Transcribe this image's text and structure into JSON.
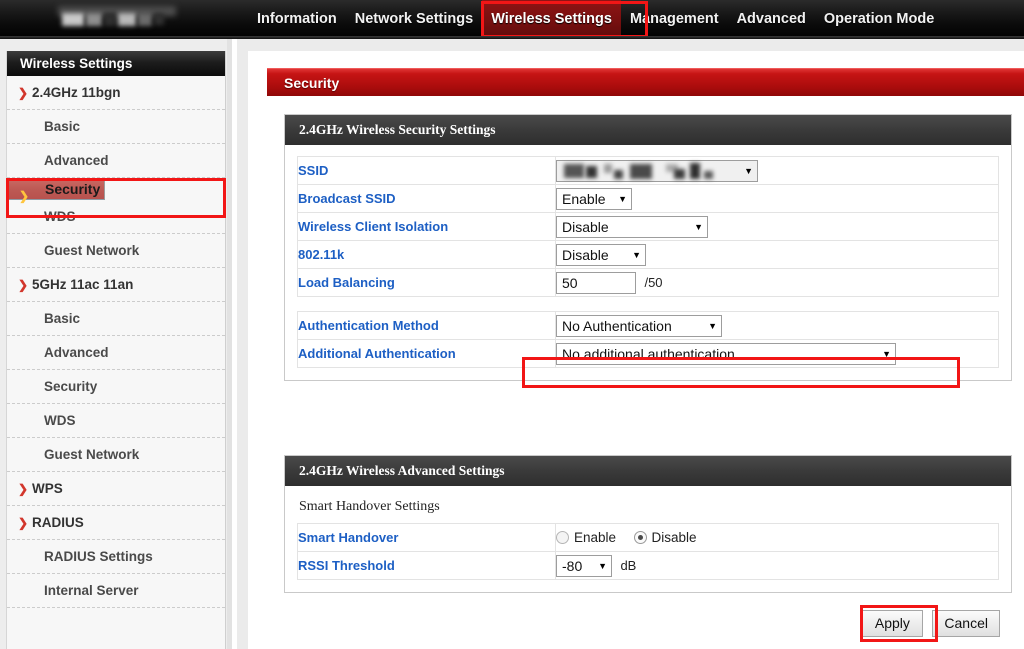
{
  "topnav": {
    "logo_alt": "redacted-vendor-logo",
    "items": [
      {
        "label": "Information",
        "active": false
      },
      {
        "label": "Network Settings",
        "active": false
      },
      {
        "label": "Wireless Settings",
        "active": true
      },
      {
        "label": "Management",
        "active": false
      },
      {
        "label": "Advanced",
        "active": false
      },
      {
        "label": "Operation Mode",
        "active": false
      }
    ]
  },
  "sidebar": {
    "title": "Wireless Settings",
    "items": [
      {
        "label": "2.4GHz 11bgn",
        "type": "group",
        "selected": false
      },
      {
        "label": "Basic",
        "type": "child",
        "selected": false
      },
      {
        "label": "Advanced",
        "type": "child",
        "selected": false
      },
      {
        "label": "Security",
        "type": "child",
        "selected": true
      },
      {
        "label": "WDS",
        "type": "child",
        "selected": false
      },
      {
        "label": "Guest Network",
        "type": "child",
        "selected": false
      },
      {
        "label": "5GHz 11ac 11an",
        "type": "group",
        "selected": false
      },
      {
        "label": "Basic",
        "type": "child",
        "selected": false
      },
      {
        "label": "Advanced",
        "type": "child",
        "selected": false
      },
      {
        "label": "Security",
        "type": "child",
        "selected": false
      },
      {
        "label": "WDS",
        "type": "child",
        "selected": false
      },
      {
        "label": "Guest Network",
        "type": "child",
        "selected": false
      },
      {
        "label": "WPS",
        "type": "group",
        "selected": false
      },
      {
        "label": "RADIUS",
        "type": "group",
        "selected": false
      },
      {
        "label": "RADIUS Settings",
        "type": "child",
        "selected": false
      },
      {
        "label": "Internal Server",
        "type": "child",
        "selected": false
      }
    ]
  },
  "page": {
    "header": "Security"
  },
  "security_panel": {
    "title": "2.4GHz Wireless Security Settings",
    "rows": {
      "ssid": {
        "label": "SSID",
        "value": "",
        "value_redacted": true
      },
      "broadcast_ssid": {
        "label": "Broadcast SSID",
        "value": "Enable"
      },
      "client_isolation": {
        "label": "Wireless Client Isolation",
        "value": "Disable"
      },
      "dot11k": {
        "label": "802.11k",
        "value": "Disable"
      },
      "load_balancing": {
        "label": "Load Balancing",
        "value": "50",
        "suffix": "/50"
      },
      "auth_method": {
        "label": "Authentication Method",
        "value": "No Authentication"
      },
      "additional_auth": {
        "label": "Additional Authentication",
        "value": "No additional authentication"
      }
    }
  },
  "advanced_panel": {
    "title": "2.4GHz Wireless Advanced Settings",
    "subheader": "Smart Handover Settings",
    "rows": {
      "smart_handover": {
        "label": "Smart Handover",
        "options": [
          {
            "label": "Enable",
            "selected": false
          },
          {
            "label": "Disable",
            "selected": true
          }
        ]
      },
      "rssi_threshold": {
        "label": "RSSI Threshold",
        "value": "-80",
        "unit": "dB"
      }
    }
  },
  "buttons": {
    "apply": "Apply",
    "cancel": "Cancel"
  },
  "icons": {
    "caret_down": "▼",
    "chevron_right": "❯"
  },
  "colors": {
    "highlight_red": "#f21616",
    "accent_red": "#c61414",
    "label_blue": "#1d5fc4",
    "selected_row": "#bd5a55"
  }
}
